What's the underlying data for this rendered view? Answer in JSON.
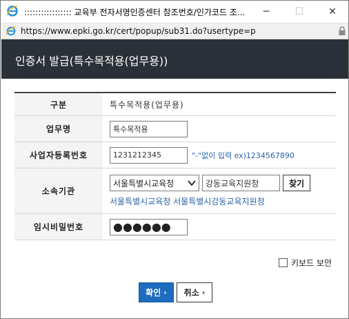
{
  "window": {
    "title": "::::::::::::::::: 교육부 전자서명인증센터 참조번호/인가코드 조...",
    "minimize": "─",
    "maximize": "☐",
    "close": "✕"
  },
  "address": {
    "url": "https://www.epki.go.kr/cert/popup/sub31.do?usertype=p"
  },
  "header": {
    "title": "인증서 발급(특수목적용(업무용))"
  },
  "form": {
    "type_label": "구분",
    "type_value": "특수목적용(업무용)",
    "work_label": "업무명",
    "work_value": "특수목적용",
    "bizno_label": "사업자등록번호",
    "bizno_value": "1231212345",
    "bizno_hint": "\"-\"없이 입력 ex)1234567890",
    "org_label": "소속기관",
    "org_select": "서울특별시교육청",
    "org_office": "강동교육지원청",
    "org_find": "찾기",
    "org_selected_text": "서울특별시교육청 서울특별시강동교육지원청",
    "pw_label": "임시비밀번호",
    "pw_value": "●●●●●●"
  },
  "options": {
    "keyboard_security": "키보드 보안"
  },
  "actions": {
    "ok": "확인",
    "cancel": "취소",
    "chevron": "›"
  },
  "colors": {
    "header_bg": "#2b3138",
    "ok_bg": "#1f6bbf",
    "link": "#2a63a8"
  }
}
